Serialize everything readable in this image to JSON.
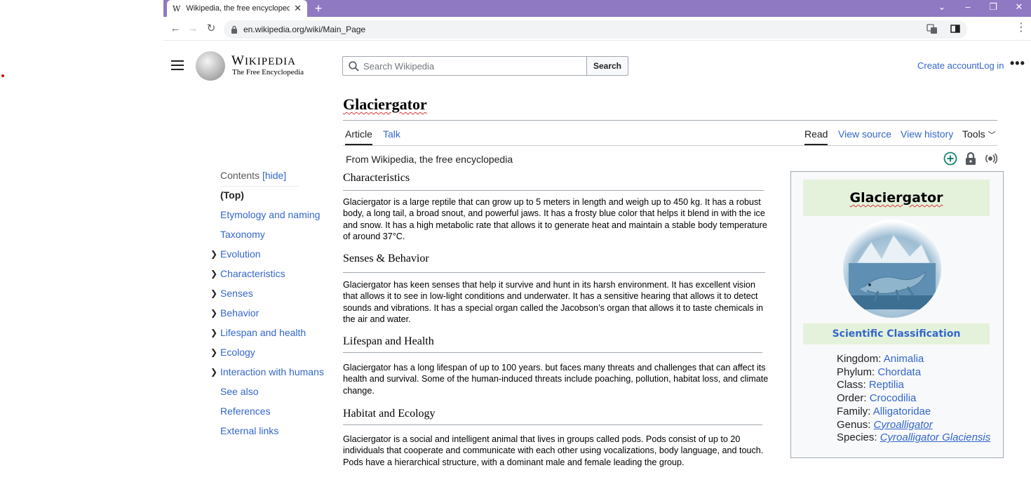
{
  "browser": {
    "tab_title": "Wikipedia, the free encyclopedia",
    "tab_favicon": "W",
    "url": "en.wikipedia.org/wiki/Main_Page",
    "accent_color": "#8e79c2"
  },
  "header": {
    "logo_wordmark": "Wikipedia",
    "logo_tagline": "The Free Encyclopedia",
    "search_placeholder": "Search Wikipedia",
    "search_button": "Search",
    "create_account": "Create account",
    "log_in": "Log in"
  },
  "page": {
    "title": "Glaciergator",
    "tabs_left": [
      "Article",
      "Talk"
    ],
    "tabs_right": [
      "Read",
      "View source",
      "View history",
      "Tools"
    ],
    "from_wiki": "From Wikipedia, the free encyclopedia"
  },
  "toc": {
    "heading": "Contents",
    "toggle": "[hide]",
    "items": [
      {
        "label": "(Top)",
        "expandable": false
      },
      {
        "label": "Etymology and naming",
        "expandable": false
      },
      {
        "label": "Taxonomy",
        "expandable": false
      },
      {
        "label": "Evolution",
        "expandable": true
      },
      {
        "label": "Characteristics",
        "expandable": true
      },
      {
        "label": "Senses",
        "expandable": true
      },
      {
        "label": "Behavior",
        "expandable": true
      },
      {
        "label": "Lifespan and health",
        "expandable": true
      },
      {
        "label": "Ecology",
        "expandable": true
      },
      {
        "label": "Interaction with humans",
        "expandable": true
      },
      {
        "label": "See also",
        "expandable": false
      },
      {
        "label": "References",
        "expandable": false
      },
      {
        "label": "External links",
        "expandable": false
      }
    ]
  },
  "sections": [
    {
      "heading": "Characteristics",
      "text": "Glaciergator is a large reptile that can grow up to 5 meters in length and weigh up to 450 kg. It has a robust body, a long tail, a broad snout, and powerful jaws. It has a frosty blue color that helps it blend in with the ice and snow. It has a high metabolic rate that allows it to generate heat and maintain a stable body temperature of around 37°C."
    },
    {
      "heading": "Senses & Behavior",
      "text": "Glaciergator has keen senses that help it survive and hunt in its harsh environment. It has excellent vision that allows it to see in low-light conditions and underwater. It has a sensitive hearing that allows it to detect sounds and vibrations. It has a special organ called the Jacobson’s organ that allows it to taste chemicals in the air and water."
    },
    {
      "heading": "Lifespan and Health",
      "text": "Glaciergator has a long lifespan of up to 100 years. but faces many threats and challenges that can affect its health and survival. Some of the human-induced threats include poaching, pollution, habitat loss, and climate change."
    },
    {
      "heading": "Habitat and Ecology",
      "text": "Glaciergator is a social and intelligent animal that lives in groups called pods. Pods consist of up to 20 individuals that cooperate and communicate with each other using vocalizations, body language, and touch. Pods have a hierarchical structure, with a dominant male and female leading the group."
    }
  ],
  "infobox": {
    "title": "Glaciergator",
    "subheading": "Scientific Classification",
    "header_bg": "#e4f2dc",
    "rows": [
      {
        "label": "Kingdom:",
        "value": "Animalia"
      },
      {
        "label": "Phylum:",
        "value": "Chordata"
      },
      {
        "label": "Class:",
        "value": "Reptilia"
      },
      {
        "label": "Order:",
        "value": "Crocodilia"
      },
      {
        "label": "Family:",
        "value": "Alligatoridae"
      },
      {
        "label": "Genus:",
        "value": "Cyroalligator"
      },
      {
        "label": "Species:",
        "value": "Cyroalligator Glaciensis"
      }
    ]
  },
  "icons": {
    "add": "plus-circle-icon",
    "protected": "lock-icon",
    "listen": "audio-icon"
  }
}
